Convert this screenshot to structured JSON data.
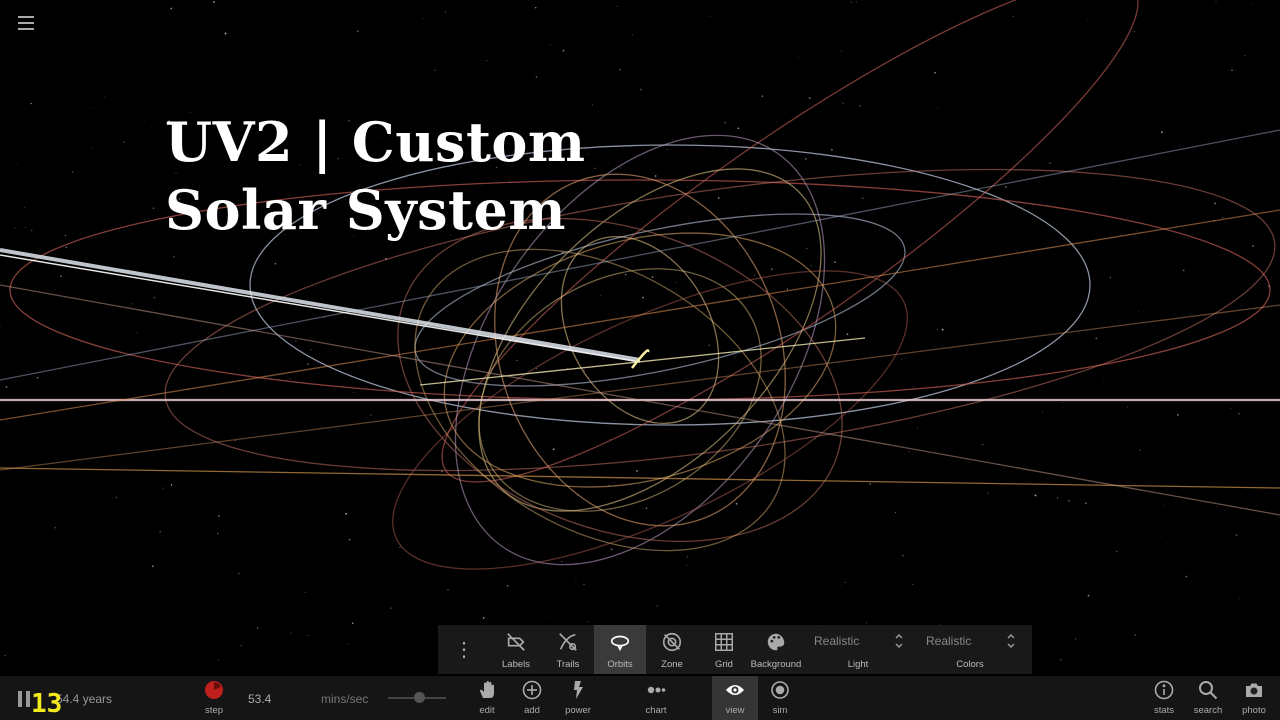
{
  "title": {
    "line1": "UV2 | Custom",
    "line2": "Solar System"
  },
  "menu_icon": "hamburger-menu-icon",
  "view_panel": {
    "items": [
      {
        "label": "Labels",
        "icon": "labels-off-icon",
        "active": false
      },
      {
        "label": "Trails",
        "icon": "trails-off-icon",
        "active": false
      },
      {
        "label": "Orbits",
        "icon": "orbits-icon",
        "active": true
      },
      {
        "label": "Zone",
        "icon": "zone-off-icon",
        "active": false
      },
      {
        "label": "Grid",
        "icon": "grid-icon",
        "active": false
      },
      {
        "label": "Background",
        "icon": "palette-icon",
        "active": false
      }
    ],
    "light": {
      "value": "Realistic",
      "label": "Light"
    },
    "colors": {
      "value": "Realistic",
      "label": "Colors"
    }
  },
  "bottom_bar": {
    "time_display": "54.4 years",
    "badge": "13",
    "step_label": "step",
    "speed_value": "53.4",
    "speed_unit": "mins/sec",
    "slider_fraction": 0.55,
    "tools": {
      "edit": "edit",
      "add": "add",
      "power": "power",
      "chart": "chart",
      "view": "view",
      "sim": "sim",
      "stats": "stats",
      "search": "search",
      "photo": "photo"
    }
  },
  "colors": {
    "background": "#000000",
    "title": "#ffffff",
    "badge": "#f2ea1f",
    "step_icon": "#c0201d"
  }
}
